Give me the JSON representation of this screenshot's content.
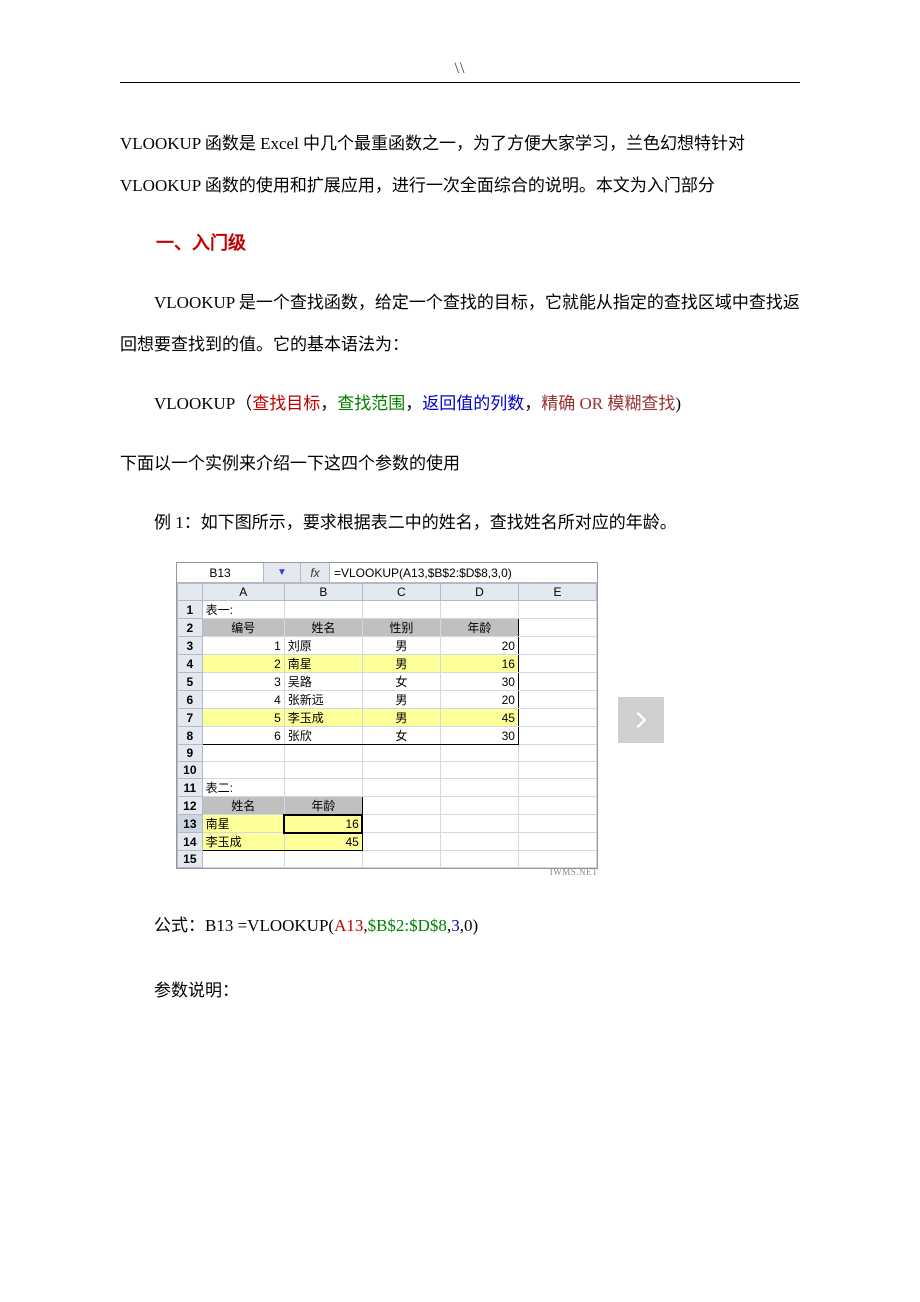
{
  "header_mark": "\\\\",
  "intro": "VLOOKUP 函数是 Excel 中几个最重函数之一，为了方便大家学习，兰色幻想特针对 VLOOKUP 函数的使用和扩展应用，进行一次全面综合的说明。本文为入门部分",
  "section1_title": "一、入门级",
  "para2": "VLOOKUP 是一个查找函数，给定一个查找的目标，它就能从指定的查找区域中查找返回想要查找到的值。它的基本语法为：",
  "syntax": {
    "fn": "VLOOKUP（",
    "a1": "查找目标",
    "c1": "，",
    "a2": "查找范围",
    "c2": "，",
    "a3": "返回值的列数",
    "c3": "，",
    "a4": "精确 OR 模糊查找",
    "tail": ")"
  },
  "para3": "下面以一个实例来介绍一下这四个参数的使用",
  "para4": "例 1：如下图所示，要求根据表二中的姓名，查找姓名所对应的年龄。",
  "excel": {
    "namebox": "B13",
    "fx_label": "fx",
    "formula": "=VLOOKUP(A13,$B$2:$D$8,3,0)",
    "cols": [
      "",
      "A",
      "B",
      "C",
      "D",
      "E"
    ],
    "t1_label": "表一:",
    "t1_headers": {
      "A": "编号",
      "B": "姓名",
      "C": "性别",
      "D": "年龄"
    },
    "t1_rows": [
      {
        "r": "3",
        "A": "1",
        "B": "刘原",
        "C": "男",
        "D": "20"
      },
      {
        "r": "4",
        "A": "2",
        "B": "南星",
        "C": "男",
        "D": "16",
        "hl": true
      },
      {
        "r": "5",
        "A": "3",
        "B": "吴路",
        "C": "女",
        "D": "30"
      },
      {
        "r": "6",
        "A": "4",
        "B": "张新远",
        "C": "男",
        "D": "20"
      },
      {
        "r": "7",
        "A": "5",
        "B": "李玉成",
        "C": "男",
        "D": "45",
        "hl": true
      },
      {
        "r": "8",
        "A": "6",
        "B": "张欣",
        "C": "女",
        "D": "30"
      }
    ],
    "t2_label": "表二:",
    "t2_headers": {
      "A": "姓名",
      "B": "年龄"
    },
    "t2_rows": [
      {
        "r": "13",
        "A": "南星",
        "B": "16"
      },
      {
        "r": "14",
        "A": "李玉成",
        "B": "45"
      }
    ],
    "watermark": "IWMS.NET"
  },
  "formula_line": {
    "label": "公式：",
    "cell": "B13 =VLOOKUP(",
    "p1": "A13",
    "c1": ",",
    "p2": "$B$2:$D$8",
    "c2": ",",
    "p3": "3",
    "c3": ",0)"
  },
  "para5": "参数说明："
}
